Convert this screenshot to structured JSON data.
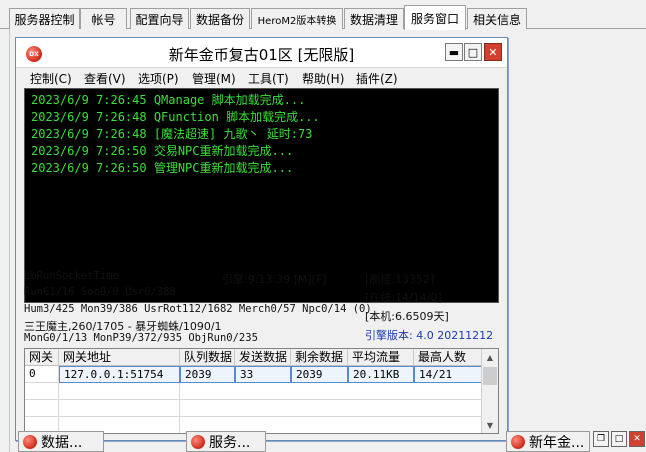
{
  "tabs": [
    {
      "label": "服务器控制",
      "active": false
    },
    {
      "label": "帐号",
      "active": false
    },
    {
      "label": "配置向导",
      "active": false
    },
    {
      "label": "数据备份",
      "active": false
    },
    {
      "label": "HeroM2版本转换",
      "active": false
    },
    {
      "label": "数据清理",
      "active": false
    },
    {
      "label": "服务窗口",
      "active": true
    },
    {
      "label": "相关信息",
      "active": false
    }
  ],
  "window": {
    "icon_text": "DX",
    "title": "新年金币复古01区 [无限版]",
    "minimize": "▬",
    "maximize": "□",
    "close": "✕"
  },
  "menu": [
    "控制(C)",
    "查看(V)",
    "选项(P)",
    "管理(M)",
    "工具(T)",
    "帮助(H)",
    "插件(Z)"
  ],
  "console_lines": [
    "2023/6/9 7:26:45 QManage 脚本加载完成...",
    "2023/6/9 7:26:48 QFunction 脚本加载完成...",
    "2023/6/9 7:26:48 [魔法超速] 九歌丶 延时:73",
    "2023/6/9 7:26:50 交易NPC重新加载完成...",
    "2023/6/9 7:26:50 管理NPC重新加载完成..."
  ],
  "status": {
    "line1": "LbRunSocketTime",
    "engine_time": "引擎:9:13:39 [M][F]",
    "brush": "[刷怪:13352]",
    "line2": "Run61/16 Soc0/0 Usr0/388",
    "online": "[在线:14/14/0]",
    "line3": "Hum3/425 Mon39/386 UsrRot112/1682 Merch0/57 Npc0/14 (0)",
    "machine": "[本机:6.6509天]",
    "line4": "三王魔主,260/1705 - 暴牙蜘蛛/1090/1",
    "version": "引擎版本: 4.0 20211212",
    "line5": "MonG0/1/13 MonP39/372/935 ObjRun0/235"
  },
  "grid": {
    "headers": [
      "网关",
      "网关地址",
      "队列数据",
      "发送数据",
      "剩余数据",
      "平均流量",
      "最高人数"
    ],
    "rows": [
      [
        "0",
        "127.0.0.1:51754",
        "2039",
        "33",
        "2039",
        "20.11KB",
        "14/21"
      ]
    ]
  },
  "taskbar": {
    "item1_label": "数据...",
    "item2_label": "服务...",
    "item3_label": "新年金..."
  }
}
